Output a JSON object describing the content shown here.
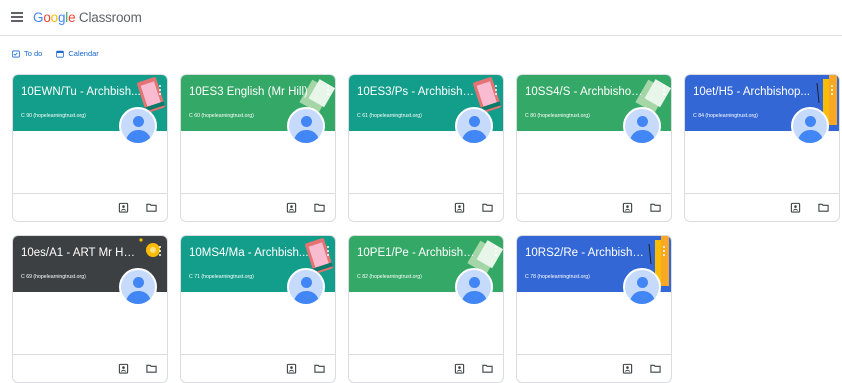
{
  "app": {
    "brand_google": "Google",
    "brand_rest": " Classroom"
  },
  "subnav": {
    "todo": "To do",
    "calendar": "Calendar"
  },
  "cards": [
    {
      "title": "10EWN/Tu - Archbish...",
      "sub": "C 90 (hopelearningtrust.org)",
      "color": "#129e8a",
      "art": "phone"
    },
    {
      "title": "10ES3 English (Mr Hill)",
      "sub": "C 60 (hopelearningtrust.org)",
      "color": "#34a866",
      "art": "books"
    },
    {
      "title": "10ES3/Ps - Archbisho...",
      "sub": "C 61 (hopelearningtrust.org)",
      "color": "#129e8a",
      "art": "phone"
    },
    {
      "title": "10SS4/S - Archbishop...",
      "sub": "C 80 (hopelearningtrust.org)",
      "color": "#34a866",
      "art": "books"
    },
    {
      "title": "10et/H5 - Archbishop...",
      "sub": "C 84 (hopelearningtrust.org)",
      "color": "#3367d6",
      "art": "pencils"
    },
    {
      "title": "10es/A1 - ART Mr Hou...",
      "sub": "C 69 (hopelearningtrust.org)",
      "color": "#3c4043",
      "art": "paint"
    },
    {
      "title": "10MS4/Ma - Archbish...",
      "sub": "C 71 (hopelearningtrust.org)",
      "color": "#129e8a",
      "art": "phone"
    },
    {
      "title": "10PE1/Pe - Archbisho...",
      "sub": "C 82 (hopelearningtrust.org)",
      "color": "#34a866",
      "art": "books"
    },
    {
      "title": "10RS2/Re - Archbisho...",
      "sub": "C 78 (hopelearningtrust.org)",
      "color": "#3367d6",
      "art": "pencils"
    }
  ],
  "icons": {
    "menu": "menu-icon",
    "todo": "todo-icon",
    "calendar": "calendar-icon",
    "assignment": "assignment-icon",
    "folder": "folder-icon",
    "more": "more-vert-icon"
  }
}
